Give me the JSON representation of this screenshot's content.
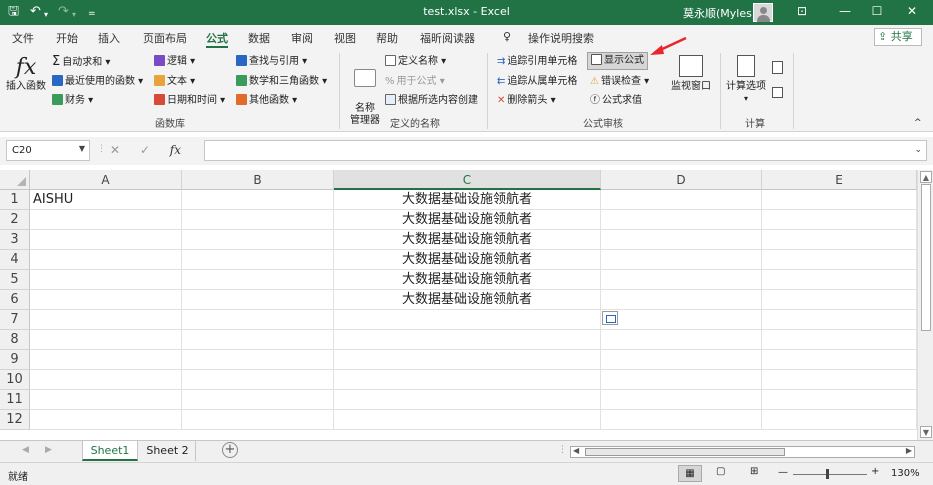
{
  "window": {
    "title": "test.xlsx  -  Excel",
    "user": "莫永顺(Myles)"
  },
  "tabs": [
    "文件",
    "开始",
    "插入",
    "页面布局",
    "公式",
    "数据",
    "审阅",
    "视图",
    "帮助",
    "福昕阅读器"
  ],
  "active_tab": "公式",
  "tell_me": "操作说明搜索",
  "share": "共享",
  "ribbon": {
    "insert_function": "插入函数",
    "autosum": "自动求和",
    "recent": "最近使用的函数",
    "financial": "财务",
    "logical": "逻辑",
    "text": "文本",
    "datetime": "日期和时间",
    "lookup": "查找与引用",
    "math": "数学和三角函数",
    "more": "其他函数",
    "group_library": "函数库",
    "name_manager": "名称\n管理器",
    "define_name": "定义名称",
    "use_in_formula": "用于公式",
    "create_from_sel": "根据所选内容创建",
    "group_names": "定义的名称",
    "trace_precedents": "追踪引用单元格",
    "trace_dependents": "追踪从属单元格",
    "remove_arrows": "删除箭头",
    "show_formulas": "显示公式",
    "error_check": "错误检查",
    "evaluate": "公式求值",
    "watch_window": "监视窗口",
    "group_audit": "公式审核",
    "calc_options": "计算选项",
    "group_calc": "计算"
  },
  "namebox": "C20",
  "columns": [
    "A",
    "B",
    "C",
    "D",
    "E"
  ],
  "rows": [
    "1",
    "2",
    "3",
    "4",
    "5",
    "6",
    "7",
    "8",
    "9",
    "10",
    "11",
    "12"
  ],
  "cells": {
    "A1": "AISHU",
    "C1": "大数据基础设施领航者",
    "C2": "大数据基础设施领航者",
    "C3": "大数据基础设施领航者",
    "C4": "大数据基础设施领航者",
    "C5": "大数据基础设施领航者",
    "C6": "大数据基础设施领航者"
  },
  "sheets": [
    "Sheet1",
    "Sheet 2"
  ],
  "active_sheet": "Sheet1",
  "status": {
    "mode": "就绪",
    "zoom": "130%"
  },
  "colors": {
    "accent": "#217346",
    "arrow": "#e8262b"
  }
}
